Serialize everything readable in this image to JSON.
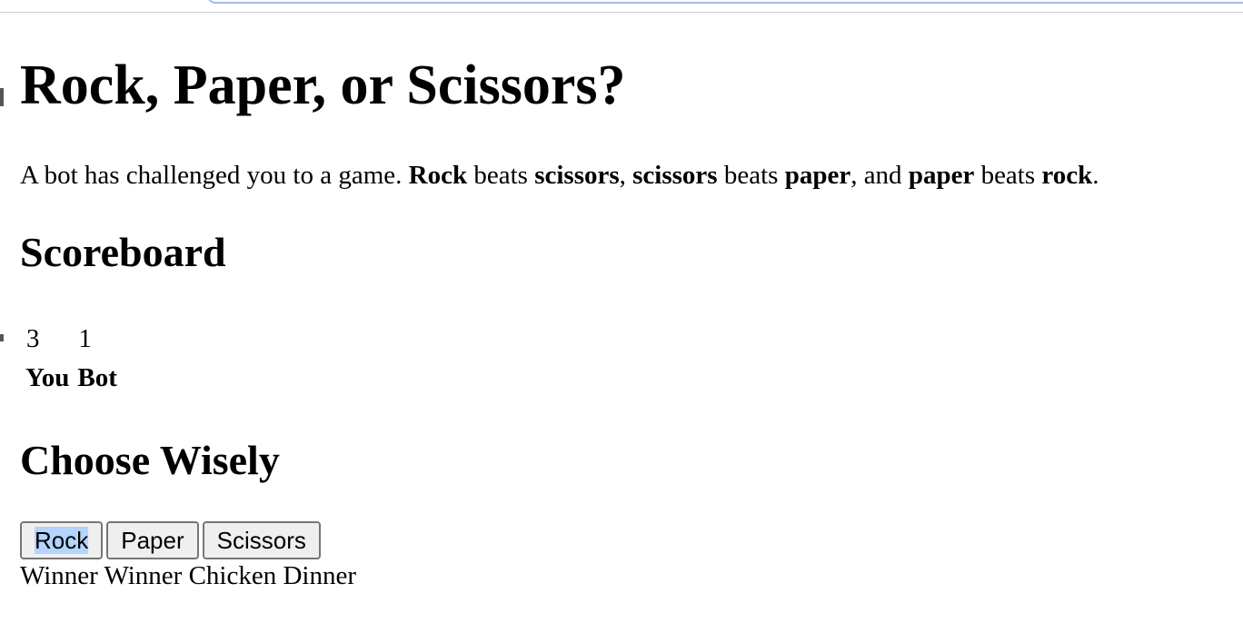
{
  "page": {
    "title": "Rock, Paper, or Scissors?",
    "intro": {
      "part1": "A bot has challenged you to a game. ",
      "rock": "Rock",
      "beats1": " beats ",
      "scissors": "scissors",
      "comma1": ", ",
      "scissors2": "scissors",
      "beats2": " beats ",
      "paper": "paper",
      "comma2": ", and ",
      "paper2": "paper",
      "beats3": " beats ",
      "rock2": "rock",
      "period": "."
    }
  },
  "scoreboard": {
    "title": "Scoreboard",
    "you_score": "3",
    "bot_score": "1",
    "you_label": "You",
    "bot_label": "Bot"
  },
  "choices": {
    "title": "Choose Wisely",
    "rock_label": "Rock",
    "paper_label": "Paper",
    "scissors_label": "Scissors",
    "selected": "Rock"
  },
  "result": {
    "message": "Winner Winner Chicken Dinner"
  },
  "colors": {
    "selection_highlight": "#b3d4fc",
    "button_background": "#efefef",
    "focus_outline": "#9fbbea"
  }
}
